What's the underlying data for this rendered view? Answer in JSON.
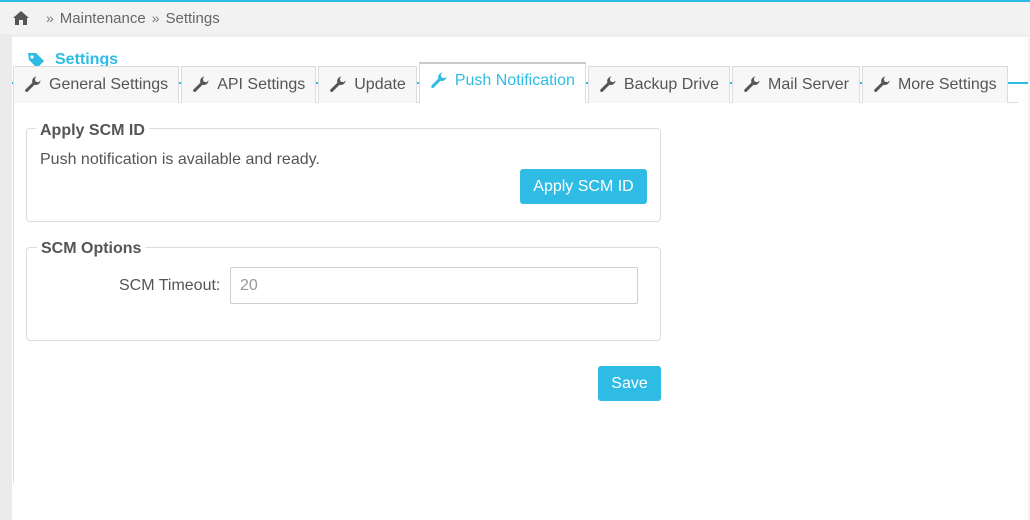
{
  "breadcrumb": {
    "home_icon": "home-icon",
    "items": [
      "Maintenance",
      "Settings"
    ],
    "separator": "»"
  },
  "panel": {
    "title": "Settings",
    "icon": "tag-icon"
  },
  "tabs": [
    {
      "label": "General Settings",
      "icon": "wrench-icon",
      "active": false
    },
    {
      "label": "API Settings",
      "icon": "wrench-icon",
      "active": false
    },
    {
      "label": "Update",
      "icon": "wrench-icon",
      "active": false
    },
    {
      "label": "Push Notification",
      "icon": "wrench-icon",
      "active": true
    },
    {
      "label": "Backup Drive",
      "icon": "wrench-icon",
      "active": false
    },
    {
      "label": "Mail Server",
      "icon": "wrench-icon",
      "active": false
    },
    {
      "label": "More Settings",
      "icon": "wrench-icon",
      "active": false
    }
  ],
  "apply_scm": {
    "legend": "Apply SCM ID",
    "status": "Push notification is available and ready.",
    "button_label": "Apply SCM ID"
  },
  "scm_options": {
    "legend": "SCM Options",
    "timeout_label": "SCM Timeout:",
    "timeout_value": "20"
  },
  "save_label": "Save",
  "colors": {
    "accent": "#2ebce4",
    "text": "#555555",
    "border": "#dcdcdc"
  }
}
